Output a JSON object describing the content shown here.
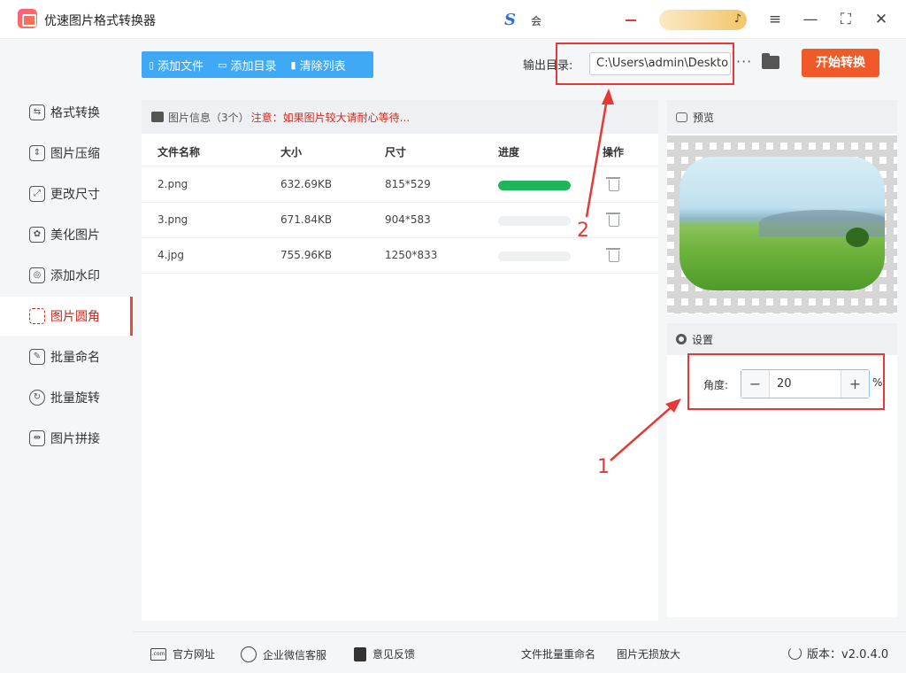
{
  "app": {
    "title": "优速图片格式转换器"
  },
  "header": {
    "vip_text": "会",
    "vip_icon": "S"
  },
  "window_controls": {
    "menu": "≡",
    "minimize": "—",
    "maximize": "⛶",
    "close": "✕"
  },
  "sidebar": {
    "items": [
      {
        "label": "格式转换",
        "icon": "convert-icon"
      },
      {
        "label": "图片压缩",
        "icon": "compress-icon"
      },
      {
        "label": "更改尺寸",
        "icon": "resize-icon"
      },
      {
        "label": "美化图片",
        "icon": "beautify-icon"
      },
      {
        "label": "添加水印",
        "icon": "watermark-icon"
      },
      {
        "label": "图片圆角",
        "icon": "rounded-corner-icon",
        "active": true
      },
      {
        "label": "批量命名",
        "icon": "rename-icon"
      },
      {
        "label": "批量旋转",
        "icon": "rotate-icon"
      },
      {
        "label": "图片拼接",
        "icon": "stitch-icon"
      }
    ]
  },
  "toolbar": {
    "add_file": "添加文件",
    "add_folder": "添加目录",
    "clear_list": "清除列表",
    "output_label": "输出目录:",
    "output_path": "C:\\Users\\admin\\Deskto",
    "more": "···",
    "start": "开始转换"
  },
  "file_panel": {
    "title": "图片信息（3个）",
    "warning": "注意：如果图片较大请耐心等待...",
    "columns": [
      "文件名称",
      "大小",
      "尺寸",
      "进度",
      "操作"
    ],
    "rows": [
      {
        "name": "2.png",
        "size": "632.69KB",
        "dims": "815*529",
        "progress": 1.0
      },
      {
        "name": "3.png",
        "size": "671.84KB",
        "dims": "904*583",
        "progress": 0.0
      },
      {
        "name": "4.jpg",
        "size": "755.96KB",
        "dims": "1250*833",
        "progress": 0.0
      }
    ]
  },
  "preview": {
    "title": "预览"
  },
  "settings": {
    "title": "设置",
    "angle_label": "角度:",
    "angle_value": "20",
    "unit": "%",
    "minus": "−",
    "plus": "+"
  },
  "annotations": {
    "label_1": "1",
    "label_2": "2",
    "color": "#e53935"
  },
  "footer": {
    "website": "官方网址",
    "wechat": "企业微信客服",
    "feedback": "意见反馈",
    "batch_rename": "文件批量重命名",
    "lossless": "图片无损放大",
    "version": "版本：v2.0.4.0"
  },
  "colors": {
    "accent": "#3fa9f5",
    "start": "#f05a28",
    "active": "#c5281c",
    "progress": "#1fb55b"
  }
}
